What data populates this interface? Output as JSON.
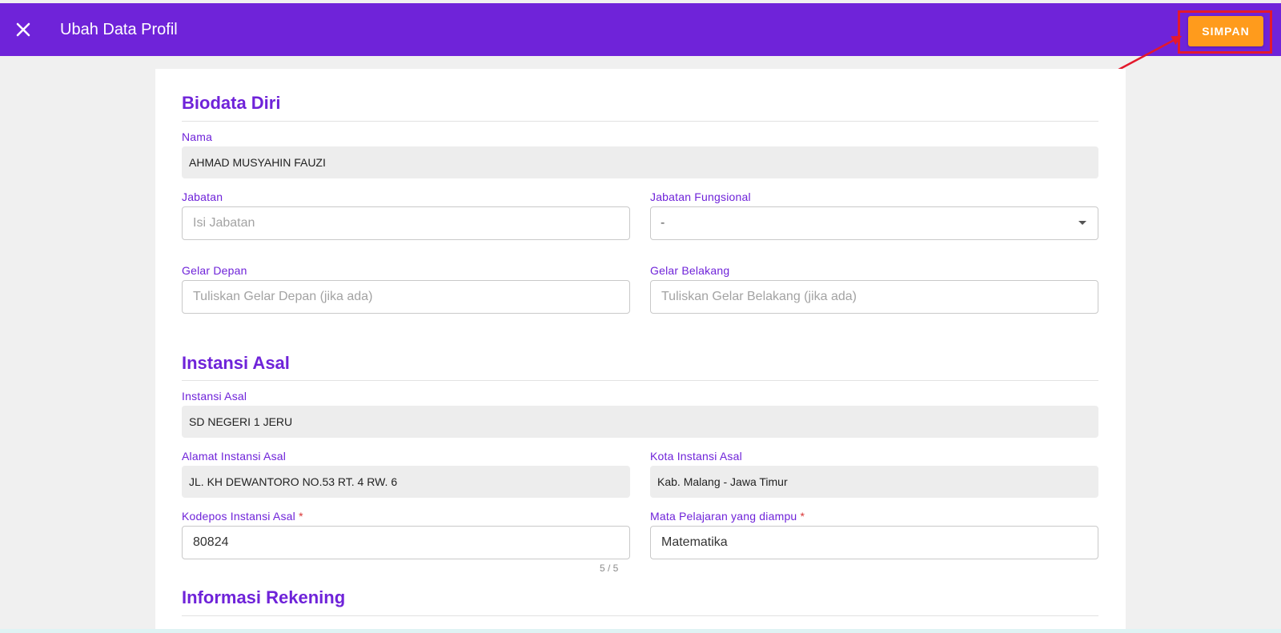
{
  "window": {
    "title": "Ubah Data Profil",
    "close_icon": "close-icon"
  },
  "toolbar": {
    "save_label": "SIMPAN"
  },
  "sections": {
    "biodata": {
      "title": "Biodata Diri"
    },
    "instansi": {
      "title": "Instansi Asal"
    },
    "rekening": {
      "title": "Informasi Rekening"
    }
  },
  "fields": {
    "nama": {
      "label": "Nama",
      "value": "AHMAD MUSYAHIN FAUZI"
    },
    "jabatan": {
      "label": "Jabatan",
      "value": "",
      "placeholder": "Isi Jabatan"
    },
    "jabatan_fungsional": {
      "label": "Jabatan Fungsional",
      "value": "-"
    },
    "gelar_depan": {
      "label": "Gelar Depan",
      "value": "",
      "placeholder": "Tuliskan Gelar Depan (jika ada)"
    },
    "gelar_belakang": {
      "label": "Gelar Belakang",
      "value": "",
      "placeholder": "Tuliskan Gelar Belakang (jika ada)"
    },
    "instansi_asal": {
      "label": "Instansi Asal",
      "value": "SD NEGERI 1 JERU"
    },
    "alamat_instansi": {
      "label": "Alamat Instansi Asal",
      "value": "JL. KH DEWANTORO NO.53 RT. 4 RW. 6"
    },
    "kota_instansi": {
      "label": "Kota Instansi Asal",
      "value": "Kab. Malang - Jawa Timur"
    },
    "kodepos": {
      "label": "Kodepos Instansi Asal",
      "required_mark": "*",
      "value": "80824",
      "counter": "5 / 5"
    },
    "mapel": {
      "label": "Mata Pelajaran yang diampu",
      "required_mark": "*",
      "value": "Matematika"
    }
  },
  "colors": {
    "header": "#6f23d9",
    "accent_button": "#ff9b1c",
    "highlight": "#e3192c"
  }
}
